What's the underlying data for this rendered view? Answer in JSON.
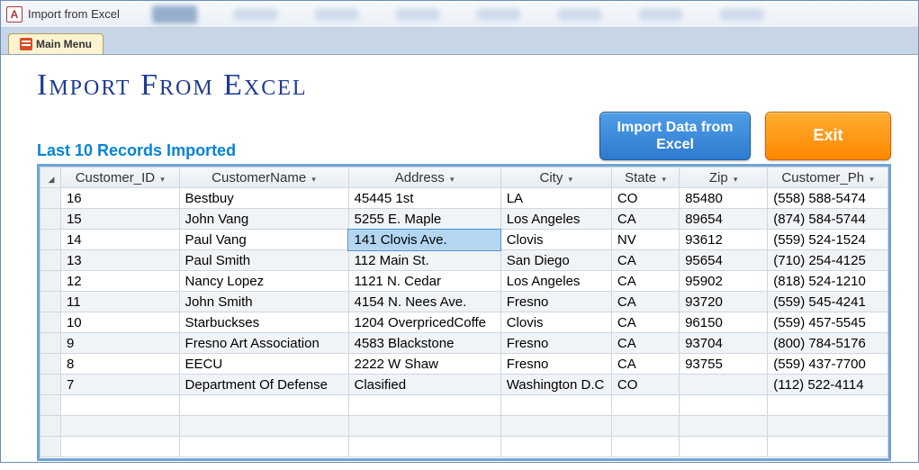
{
  "window": {
    "title": "Import from Excel"
  },
  "tab": {
    "label": "Main Menu"
  },
  "header": {
    "title": "Import From Excel",
    "subtitle": "Last 10 Records Imported"
  },
  "buttons": {
    "import_label": "Import Data from Excel",
    "exit_label": "Exit"
  },
  "grid": {
    "columns": [
      "Customer_ID",
      "CustomerName",
      "Address",
      "City",
      "State",
      "Zip",
      "Customer_Ph"
    ],
    "selected": {
      "row": 2,
      "col": 2
    },
    "rows": [
      {
        "Customer_ID": "16",
        "CustomerName": "Bestbuy",
        "Address": "45445 1st",
        "City": "LA",
        "State": "CO",
        "Zip": "85480",
        "Customer_Ph": "(558) 588-5474"
      },
      {
        "Customer_ID": "15",
        "CustomerName": "John Vang",
        "Address": "5255 E. Maple",
        "City": "Los Angeles",
        "State": "CA",
        "Zip": "89654",
        "Customer_Ph": "(874) 584-5744"
      },
      {
        "Customer_ID": "14",
        "CustomerName": "Paul Vang",
        "Address": "141 Clovis Ave.",
        "City": "Clovis",
        "State": "NV",
        "Zip": "93612",
        "Customer_Ph": "(559) 524-1524"
      },
      {
        "Customer_ID": "13",
        "CustomerName": "Paul Smith",
        "Address": "112 Main St.",
        "City": "San Diego",
        "State": "CA",
        "Zip": "95654",
        "Customer_Ph": "(710) 254-4125"
      },
      {
        "Customer_ID": "12",
        "CustomerName": "Nancy Lopez",
        "Address": "1121 N. Cedar",
        "City": "Los Angeles",
        "State": "CA",
        "Zip": "95902",
        "Customer_Ph": "(818) 524-1210"
      },
      {
        "Customer_ID": "11",
        "CustomerName": "John Smith",
        "Address": "4154 N. Nees Ave.",
        "City": "Fresno",
        "State": "CA",
        "Zip": "93720",
        "Customer_Ph": "(559) 545-4241"
      },
      {
        "Customer_ID": "10",
        "CustomerName": "Starbuckses",
        "Address": "1204 OverpricedCoffe",
        "City": "Clovis",
        "State": "CA",
        "Zip": "96150",
        "Customer_Ph": "(559) 457-5545"
      },
      {
        "Customer_ID": "9",
        "CustomerName": "Fresno Art Association",
        "Address": "4583 Blackstone",
        "City": "Fresno",
        "State": "CA",
        "Zip": "93704",
        "Customer_Ph": "(800) 784-5176"
      },
      {
        "Customer_ID": "8",
        "CustomerName": "EECU",
        "Address": "2222 W Shaw",
        "City": "Fresno",
        "State": "CA",
        "Zip": "93755",
        "Customer_Ph": "(559) 437-7700"
      },
      {
        "Customer_ID": "7",
        "CustomerName": "Department Of Defense",
        "Address": "Clasified",
        "City": "Washington D.C",
        "State": "CO",
        "Zip": "",
        "Customer_Ph": "(112) 522-4114"
      }
    ]
  }
}
